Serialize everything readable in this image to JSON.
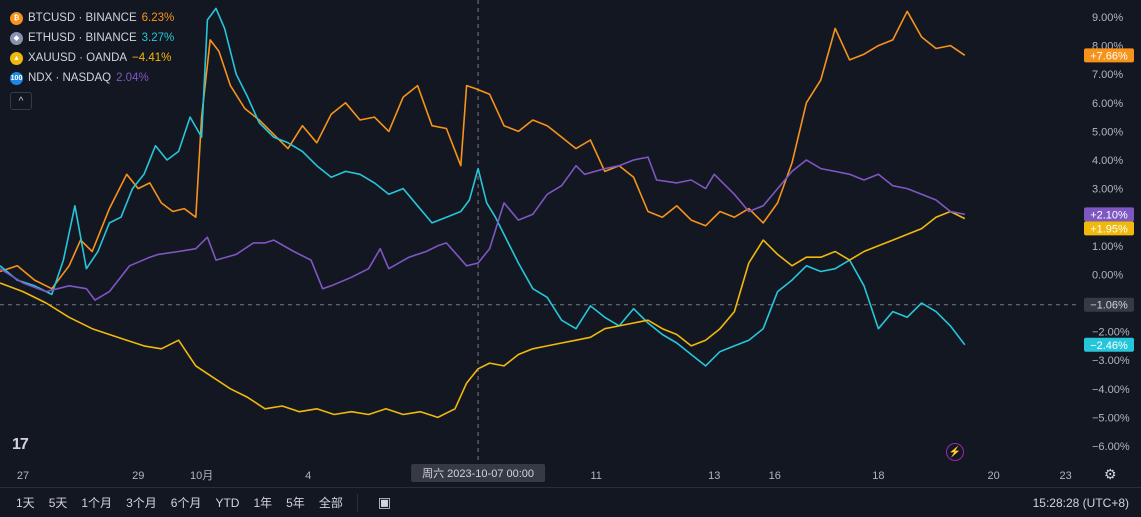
{
  "legend": [
    {
      "symbol": "BTCUSD · BINANCE",
      "value": "6.23%",
      "color": "#f7931a",
      "icon": "bitcoin-icon",
      "glyph": "₿"
    },
    {
      "symbol": "ETHUSD · BINANCE",
      "value": "3.27%",
      "color": "#26c6da",
      "icon": "ethereum-icon",
      "glyph": "◆"
    },
    {
      "symbol": "XAUUSD · OANDA",
      "value": "−4.41%",
      "color": "#f0b90b",
      "icon": "gold-icon",
      "glyph": "▲"
    },
    {
      "symbol": "NDX · NASDAQ",
      "value": "2.04%",
      "color": "#7e57c2",
      "icon": "ndx-icon",
      "glyph": "100"
    }
  ],
  "collapse_glyph": "^",
  "crosshair": {
    "date_label": "周六 2023-10-07   00:00",
    "value_label": "−1.06%"
  },
  "bottom_bar": {
    "ranges": [
      "1天",
      "5天",
      "1个月",
      "3个月",
      "6个月",
      "YTD",
      "1年",
      "5年",
      "全部"
    ],
    "time": "15:28:28 (UTC+8)"
  },
  "logo_text": "17",
  "chart_data": {
    "type": "line",
    "ylim": [
      -6.5,
      9.6
    ],
    "y_ticks": [
      9,
      8,
      7,
      6,
      5,
      4,
      3,
      2,
      1,
      0,
      -1,
      -2,
      -3,
      -4,
      -5,
      -6
    ],
    "y_tick_labels": [
      "9.00%",
      "8.00%",
      "7.00%",
      "6.00%",
      "5.00%",
      "4.00%",
      "3.00%",
      "2.00%",
      "1.00%",
      "0.00%",
      "−1.00%",
      "−2.00%",
      "−3.00%",
      "−4.00%",
      "−5.00%",
      "−6.00%"
    ],
    "x_range": [
      0,
      37.5
    ],
    "x_ticks": [
      {
        "x": 0.8,
        "label": "27"
      },
      {
        "x": 4.8,
        "label": "29"
      },
      {
        "x": 7.0,
        "label": "10月"
      },
      {
        "x": 10.7,
        "label": "4"
      },
      {
        "x": 20.7,
        "label": "11"
      },
      {
        "x": 24.8,
        "label": "13"
      },
      {
        "x": 26.9,
        "label": "16"
      },
      {
        "x": 30.5,
        "label": "18"
      },
      {
        "x": 34.5,
        "label": "20"
      },
      {
        "x": 37.0,
        "label": "23"
      }
    ],
    "crosshair_x": 16.6,
    "crosshair_y": -1.06,
    "series": [
      {
        "name": "BTCUSD",
        "color": "#f7931a",
        "last_label": "+7.66%",
        "last": 7.66,
        "x": [
          0,
          0.6,
          1.2,
          1.8,
          2.4,
          2.8,
          3.2,
          3.8,
          4.4,
          4.8,
          5.2,
          5.6,
          6.0,
          6.4,
          6.8,
          7.0,
          7.3,
          7.6,
          8.0,
          8.5,
          9.0,
          9.5,
          10.0,
          10.5,
          11.0,
          11.5,
          12.0,
          12.5,
          13.0,
          13.5,
          14.0,
          14.5,
          15.0,
          15.5,
          16.0,
          16.2,
          16.5,
          17.0,
          17.5,
          18.0,
          18.5,
          19.0,
          19.5,
          20.0,
          20.5,
          21.0,
          21.5,
          22.0,
          22.5,
          23.0,
          23.5,
          24.0,
          24.5,
          25.0,
          25.5,
          26.0,
          26.5,
          27.0,
          27.5,
          28.0,
          28.5,
          29.0,
          29.5,
          30.0,
          30.5,
          31.0,
          31.5,
          32.0,
          32.5,
          33.0,
          33.5
        ],
        "y": [
          0.1,
          0.3,
          -0.2,
          -0.5,
          0.3,
          1.2,
          0.8,
          2.3,
          3.5,
          3.0,
          3.2,
          2.5,
          2.2,
          2.3,
          2.0,
          5.5,
          8.2,
          7.8,
          6.6,
          5.8,
          5.4,
          4.9,
          4.4,
          5.2,
          4.6,
          5.6,
          6.0,
          5.4,
          5.5,
          5.0,
          6.2,
          6.6,
          5.2,
          5.1,
          3.8,
          6.6,
          6.5,
          6.3,
          5.2,
          5.0,
          5.4,
          5.2,
          4.8,
          4.4,
          4.7,
          3.6,
          3.8,
          3.4,
          2.2,
          2.0,
          2.4,
          1.9,
          1.7,
          2.2,
          2.0,
          2.3,
          1.8,
          2.5,
          3.9,
          6.0,
          6.8,
          8.6,
          7.5,
          7.7,
          8.0,
          8.2,
          9.2,
          8.3,
          7.9,
          8.0,
          7.66
        ]
      },
      {
        "name": "ETHUSD",
        "color": "#26c6da",
        "last_label": "−2.46%",
        "last": -2.46,
        "x": [
          0,
          0.6,
          1.2,
          1.8,
          2.2,
          2.6,
          3.0,
          3.4,
          3.8,
          4.2,
          4.6,
          5.0,
          5.4,
          5.8,
          6.2,
          6.6,
          7.0,
          7.2,
          7.5,
          7.8,
          8.2,
          8.6,
          9.0,
          9.5,
          10.0,
          10.5,
          11.0,
          11.5,
          12.0,
          12.5,
          13.0,
          13.5,
          14.0,
          14.5,
          15.0,
          15.5,
          16.0,
          16.3,
          16.6,
          16.9,
          17.2,
          17.6,
          18.0,
          18.5,
          19.0,
          19.5,
          20.0,
          20.5,
          21.0,
          21.5,
          22.0,
          22.5,
          23.0,
          23.5,
          24.0,
          24.5,
          25.0,
          25.5,
          26.0,
          26.5,
          27.0,
          27.5,
          28.0,
          28.5,
          29.0,
          29.5,
          30.0,
          30.5,
          31.0,
          31.5,
          32.0,
          32.5,
          33.0,
          33.5
        ],
        "y": [
          0.3,
          -0.2,
          -0.4,
          -0.7,
          0.5,
          2.4,
          0.2,
          0.8,
          1.8,
          2.0,
          3.0,
          3.5,
          4.5,
          4.0,
          4.3,
          5.5,
          4.8,
          8.9,
          9.3,
          8.6,
          7.0,
          6.2,
          5.3,
          4.8,
          4.6,
          4.3,
          3.8,
          3.4,
          3.6,
          3.5,
          3.2,
          2.8,
          3.0,
          2.4,
          1.8,
          2.0,
          2.2,
          2.6,
          3.7,
          2.5,
          2.0,
          1.2,
          0.4,
          -0.5,
          -0.8,
          -1.6,
          -1.9,
          -1.1,
          -1.5,
          -1.8,
          -1.2,
          -1.7,
          -2.1,
          -2.4,
          -2.8,
          -3.2,
          -2.7,
          -2.5,
          -2.3,
          -1.9,
          -0.6,
          -0.2,
          0.3,
          0.1,
          0.2,
          0.5,
          -0.4,
          -1.9,
          -1.3,
          -1.5,
          -1.0,
          -1.3,
          -1.8,
          -2.46
        ]
      },
      {
        "name": "XAUUSD",
        "color": "#f0b90b",
        "last_label": "+1.95%",
        "last": 1.95,
        "x": [
          0,
          0.8,
          1.6,
          2.4,
          3.2,
          3.8,
          4.4,
          5.0,
          5.6,
          6.2,
          6.8,
          7.4,
          8.0,
          8.6,
          9.2,
          9.8,
          10.4,
          11.0,
          11.6,
          12.2,
          12.8,
          13.4,
          14.0,
          14.6,
          15.2,
          15.8,
          16.2,
          16.6,
          17.0,
          17.5,
          18.0,
          18.5,
          19.0,
          19.5,
          20.0,
          20.5,
          21.0,
          21.5,
          22.0,
          22.5,
          23.0,
          23.5,
          24.0,
          24.5,
          25.0,
          25.5,
          26.0,
          26.5,
          27.0,
          27.5,
          28.0,
          28.5,
          29.0,
          29.5,
          30.0,
          30.5,
          31.0,
          31.5,
          32.0,
          32.5,
          33.0,
          33.5
        ],
        "y": [
          -0.3,
          -0.6,
          -1.0,
          -1.5,
          -1.9,
          -2.1,
          -2.3,
          -2.5,
          -2.6,
          -2.3,
          -3.2,
          -3.6,
          -4.0,
          -4.3,
          -4.7,
          -4.6,
          -4.8,
          -4.7,
          -4.9,
          -4.8,
          -4.9,
          -4.7,
          -4.9,
          -4.8,
          -5.0,
          -4.7,
          -3.8,
          -3.3,
          -3.1,
          -3.2,
          -2.8,
          -2.6,
          -2.5,
          -2.4,
          -2.3,
          -2.2,
          -1.9,
          -1.8,
          -1.7,
          -1.6,
          -1.9,
          -2.1,
          -2.5,
          -2.3,
          -1.9,
          -1.3,
          0.4,
          1.2,
          0.7,
          0.3,
          0.6,
          0.6,
          0.8,
          0.5,
          0.8,
          1.0,
          1.2,
          1.4,
          1.6,
          2.0,
          2.2,
          1.95
        ]
      },
      {
        "name": "NDX",
        "color": "#7e57c2",
        "last_label": "+2.10%",
        "last": 2.1,
        "x": [
          0,
          0.8,
          1.6,
          2.4,
          3.0,
          3.3,
          3.8,
          4.5,
          5.2,
          5.5,
          6.2,
          6.8,
          7.2,
          7.5,
          8.2,
          8.8,
          9.2,
          9.5,
          10.2,
          10.8,
          11.2,
          11.5,
          12.2,
          12.8,
          13.2,
          13.5,
          14.2,
          14.8,
          15.2,
          15.5,
          16.2,
          16.6,
          17.0,
          17.5,
          18.0,
          18.5,
          19.0,
          19.5,
          20.0,
          20.3,
          21.0,
          21.5,
          22.0,
          22.5,
          22.8,
          23.5,
          24.0,
          24.5,
          24.8,
          25.5,
          26.0,
          26.5,
          27.0,
          27.5,
          28.0,
          28.5,
          29.0,
          29.5,
          30.0,
          30.5,
          31.0,
          31.5,
          32.0,
          32.5,
          33.0,
          33.5
        ],
        "y": [
          0.2,
          -0.3,
          -0.6,
          -0.4,
          -0.5,
          -0.9,
          -0.6,
          0.3,
          0.6,
          0.7,
          0.8,
          0.9,
          1.3,
          0.5,
          0.7,
          1.1,
          1.1,
          1.2,
          0.8,
          0.5,
          -0.5,
          -0.4,
          -0.1,
          0.2,
          0.9,
          0.2,
          0.6,
          0.8,
          1.0,
          1.1,
          0.3,
          0.4,
          0.9,
          2.5,
          1.9,
          2.1,
          2.8,
          3.1,
          3.8,
          3.5,
          3.7,
          3.8,
          4.0,
          4.1,
          3.3,
          3.2,
          3.3,
          3.0,
          3.5,
          2.8,
          2.2,
          2.4,
          3.0,
          3.6,
          4.0,
          3.7,
          3.6,
          3.5,
          3.3,
          3.5,
          3.1,
          3.0,
          2.8,
          2.6,
          2.2,
          2.1
        ]
      }
    ]
  }
}
